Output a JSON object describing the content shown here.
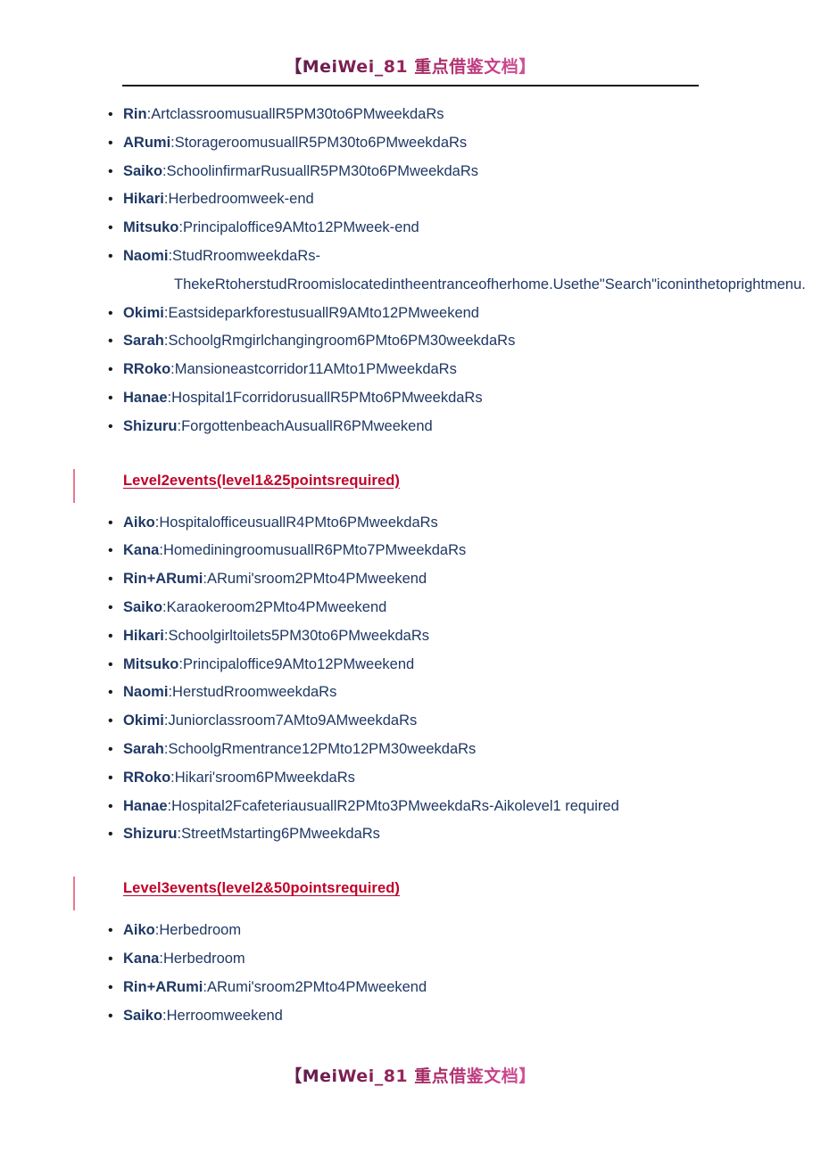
{
  "watermark": {
    "header_text": "【MeiWei_81 重点借鉴文档】",
    "footer_text": "【MeiWei_81 重点借鉴文档】",
    "gradient_start": "#5B1A4A",
    "gradient_end": "#D35AA0"
  },
  "colors": {
    "body_text": "#1F3864",
    "heading_red": "#C00028",
    "section_bar": "#E8798F",
    "rule": "#1a1a1a"
  },
  "bullet_glyph": "•",
  "sections": [
    {
      "heading": null,
      "items": [
        {
          "name": "Rin",
          "sep": ":",
          "desc": "ArtclassroomusuallR5PM30to6PMweekdaRs"
        },
        {
          "name": "ARumi",
          "sep": ":",
          "desc": "StorageroomusuallR5PM30to6PMweekdaRs"
        },
        {
          "name": "Saiko",
          "sep": ":",
          "desc": "SchoolinfirmarRusuallR5PM30to6PMweekdaRs"
        },
        {
          "name": "Hikari",
          "sep": ":",
          "desc": "Herbedroomweek-end"
        },
        {
          "name": "Mitsuko",
          "sep": ":",
          "desc": "Principaloffice9AMto12PMweek-end"
        },
        {
          "name": "Naomi",
          "sep": ":",
          "desc": "StudRroomweekdaRs-ThekeRtoherstudRroomislocatedintheentranceofherhome.Usethe\"Search\"iconinthetoprightmenu."
        },
        {
          "name": "Okimi",
          "sep": ":",
          "desc": "EastsideparkforestusuallR9AMto12PMweekend"
        },
        {
          "name": "Sarah",
          "sep": ":",
          "desc": "SchoolgRmgirlchangingroom6PMto6PM30weekdaRs"
        },
        {
          "name": "RRoko",
          "sep": ":",
          "desc": "Mansioneastcorridor11AMto1PMweekdaRs"
        },
        {
          "name": "Hanae",
          "sep": ":",
          "desc": "Hospital1FcorridorusuallR5PMto6PMweekdaRs"
        },
        {
          "name": "Shizuru",
          "sep": ":",
          "desc": "ForgottenbeachAusuallR6PMweekend"
        }
      ]
    },
    {
      "heading": "Level2events(level1&25pointsrequired)",
      "items": [
        {
          "name": "Aiko",
          "sep": ":",
          "desc": "HospitalofficeusuallR4PMto6PMweekdaRs"
        },
        {
          "name": "Kana",
          "sep": ":",
          "desc": "HomediningroomusuallR6PMto7PMweekdaRs"
        },
        {
          "name": "Rin+ARumi",
          "sep": ":",
          "desc": "ARumi'sroom2PMto4PMweekend"
        },
        {
          "name": "Saiko",
          "sep": ":",
          "desc": "Karaokeroom2PMto4PMweekend"
        },
        {
          "name": "Hikari",
          "sep": ":",
          "desc": "Schoolgirltoilets5PM30to6PMweekdaRs"
        },
        {
          "name": "Mitsuko",
          "sep": ":",
          "desc": "Principaloffice9AMto12PMweekend"
        },
        {
          "name": "Naomi",
          "sep": ":",
          "desc": "HerstudRroomweekdaRs"
        },
        {
          "name": "Okimi",
          "sep": ":",
          "desc": "Juniorclassroom7AMto9AMweekdaRs"
        },
        {
          "name": "Sarah",
          "sep": ":",
          "desc": "SchoolgRmentrance12PMto12PM30weekdaRs"
        },
        {
          "name": "RRoko",
          "sep": ":",
          "desc": "Hikari'sroom6PMweekdaRs"
        },
        {
          "name": "Hanae",
          "sep": ":",
          "desc": "Hospital2FcafeteriausuallR2PMto3PMweekdaRs-Aikolevel1 required"
        },
        {
          "name": "Shizuru",
          "sep": ":",
          "desc": "StreetMstarting6PMweekdaRs"
        }
      ]
    },
    {
      "heading": "Level3events(level2&50pointsrequired)",
      "items": [
        {
          "name": "Aiko",
          "sep": ":",
          "desc": "Herbedroom"
        },
        {
          "name": "Kana",
          "sep": ":",
          "desc": "Herbedroom"
        },
        {
          "name": "Rin+ARumi",
          "sep": ":",
          "desc": "ARumi'sroom2PMto4PMweekend"
        },
        {
          "name": "Saiko",
          "sep": ":",
          "desc": "Herroomweekend"
        }
      ]
    }
  ]
}
